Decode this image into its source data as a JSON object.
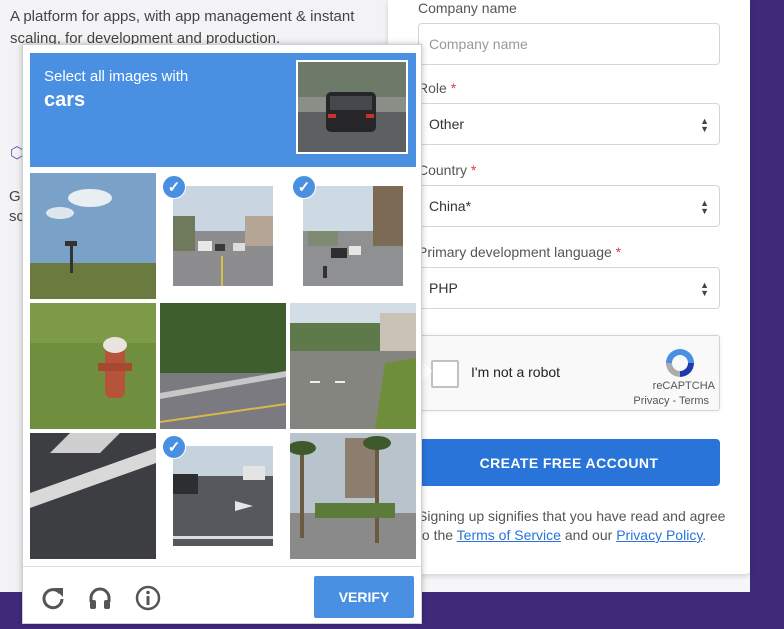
{
  "background": {
    "intro_text": "A platform for apps, with app management & instant scaling, for development and production.",
    "fragment_1": "G",
    "fragment_2": "sc"
  },
  "form": {
    "company_label": "Company name",
    "company_placeholder": "Company name",
    "role_label": "Role",
    "role_value": "Other",
    "country_label": "Country",
    "country_value": "China*",
    "language_label": "Primary development language",
    "language_value": "PHP",
    "required_mark": "*",
    "recaptcha": {
      "checkbox_label": "I'm not a robot",
      "brand": "reCAPTCHA",
      "privacy": "Privacy",
      "separator": "-",
      "terms": "Terms"
    },
    "create_button": "CREATE FREE ACCOUNT",
    "legal_prefix": "Signing up signifies that you have read and agree to the",
    "terms_link": "Terms of Service",
    "legal_and": "and our",
    "privacy_link": "Privacy Policy",
    "legal_suffix": "."
  },
  "challenge": {
    "instruction": "Select all images with",
    "target": "cars",
    "tiles": [
      {
        "scene": "sky-field-tower",
        "selected": false
      },
      {
        "scene": "street-cars",
        "selected": true
      },
      {
        "scene": "street-intersection",
        "selected": true
      },
      {
        "scene": "fire-hydrant-grass",
        "selected": false
      },
      {
        "scene": "road-guardrail",
        "selected": false
      },
      {
        "scene": "road-crossing",
        "selected": false
      },
      {
        "scene": "asphalt-crosswalk",
        "selected": false
      },
      {
        "scene": "road-arrow",
        "selected": true
      },
      {
        "scene": "palm-trees",
        "selected": false
      }
    ],
    "verify_button": "VERIFY",
    "footer_icons": [
      "reload-icon",
      "audio-icon",
      "info-icon"
    ]
  },
  "colors": {
    "accent": "#4a90e2",
    "cta": "#2874d9",
    "brand_purple": "#3f2a7a",
    "required": "#e0393e"
  }
}
